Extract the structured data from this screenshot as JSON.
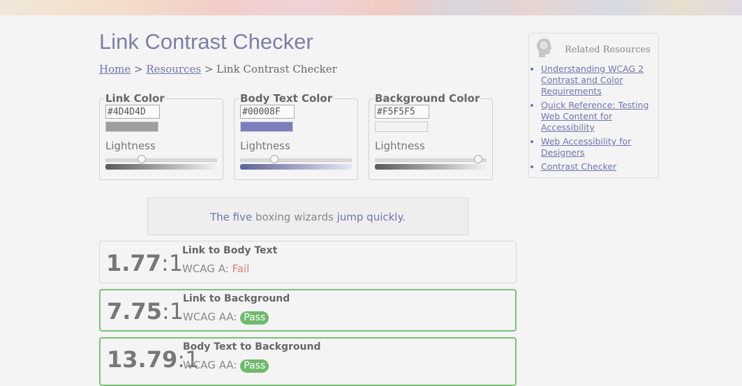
{
  "page": {
    "title": "Link Contrast Checker",
    "breadcrumb": {
      "home": "Home",
      "sep1": " > ",
      "resources": "Resources",
      "sep2": " > ",
      "current": "Link Contrast Checker"
    }
  },
  "pickers": [
    {
      "legend": "Link Color",
      "hex": "#4D4D4D",
      "lightness_label": "Lightness",
      "swatch": "#9e9e9e",
      "lightness": 0.31,
      "gradient": [
        "#5a5a5a",
        "#f2f2f2"
      ]
    },
    {
      "legend": "Body Text Color",
      "hex": "#00008F",
      "lightness_label": "Lightness",
      "swatch": "#7b7fbd",
      "lightness": 0.29,
      "gradient": [
        "#5d6096",
        "#e6e6f6"
      ]
    },
    {
      "legend": "Background Color",
      "hex": "#F5F5F5",
      "lightness_label": "Lightness",
      "swatch": "#f3f3f3",
      "lightness": 0.96,
      "gradient": [
        "#5a5a5a",
        "#f2f2f2"
      ]
    }
  ],
  "sample": {
    "part1": "The five",
    "part2": " boxing wizards ",
    "part3": "jump quickly."
  },
  "results": [
    {
      "ratio": "1.77",
      "suffix": ":1",
      "title": "Link to Body Text",
      "level": "WCAG A: ",
      "status": "Fail"
    },
    {
      "ratio": "7.75",
      "suffix": ":1",
      "title": "Link to Background",
      "level": "WCAG AA: ",
      "status": "Pass"
    },
    {
      "ratio": "13.79",
      "suffix": ":1",
      "title": "Body Text to Background",
      "level": "WCAG AA: ",
      "status": "Pass"
    }
  ],
  "related": {
    "heading": "Related Resources",
    "icon": "head-gear-icon",
    "links": [
      "Understanding WCAG 2 Contrast and Color Requirements",
      "Quick Reference: Testing Web Content for Accessibility",
      "Web Accessibility for Designers",
      "Contrast Checker"
    ]
  },
  "colors": {
    "title": "#7c7fa6",
    "link": "#6f74b2",
    "pass_border": "#7cc07c",
    "pass_badge": "#6fba6f",
    "fail_text": "#d9826e"
  }
}
